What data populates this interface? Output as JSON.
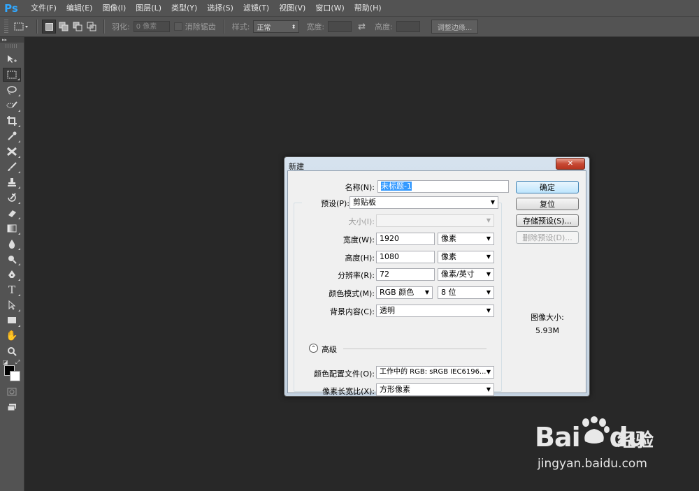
{
  "app": {
    "logo": "Ps"
  },
  "menu": [
    "文件(F)",
    "编辑(E)",
    "图像(I)",
    "图层(L)",
    "类型(Y)",
    "选择(S)",
    "滤镜(T)",
    "视图(V)",
    "窗口(W)",
    "帮助(H)"
  ],
  "options": {
    "feather_label": "羽化:",
    "feather_value": "0 像素",
    "antialias_label": "消除锯齿",
    "style_label": "样式:",
    "style_value": "正常",
    "width_label": "宽度:",
    "height_label": "高度:",
    "refine_edge_button": "调整边缘..."
  },
  "dialog": {
    "title": "新建",
    "close": "✕",
    "name_label": "名称(N):",
    "name_value": "未标题-1",
    "preset_label": "预设(P):",
    "preset_value": "剪贴板",
    "size_label": "大小(I):",
    "width_label": "宽度(W):",
    "width_value": "1920",
    "width_unit": "像素",
    "height_label": "高度(H):",
    "height_value": "1080",
    "height_unit": "像素",
    "resolution_label": "分辨率(R):",
    "resolution_value": "72",
    "resolution_unit": "像素/英寸",
    "color_mode_label": "颜色模式(M):",
    "color_mode_value": "RGB 颜色",
    "bit_depth_value": "8 位",
    "background_label": "背景内容(C):",
    "background_value": "透明",
    "advanced_label": "高级",
    "color_profile_label": "颜色配置文件(O):",
    "color_profile_value": "工作中的 RGB: sRGB IEC6196...",
    "pixel_aspect_label": "像素长宽比(X):",
    "pixel_aspect_value": "方形像素",
    "ok_button": "确定",
    "reset_button": "复位",
    "save_preset_button": "存储预设(S)...",
    "delete_preset_button": "删除预设(D)...",
    "image_size_label": "图像大小:",
    "image_size_value": "5.93M"
  },
  "watermark": {
    "logo": "Bai",
    "logo_du": "du",
    "cn": "经验",
    "url": "jingyan.baidu.com"
  }
}
